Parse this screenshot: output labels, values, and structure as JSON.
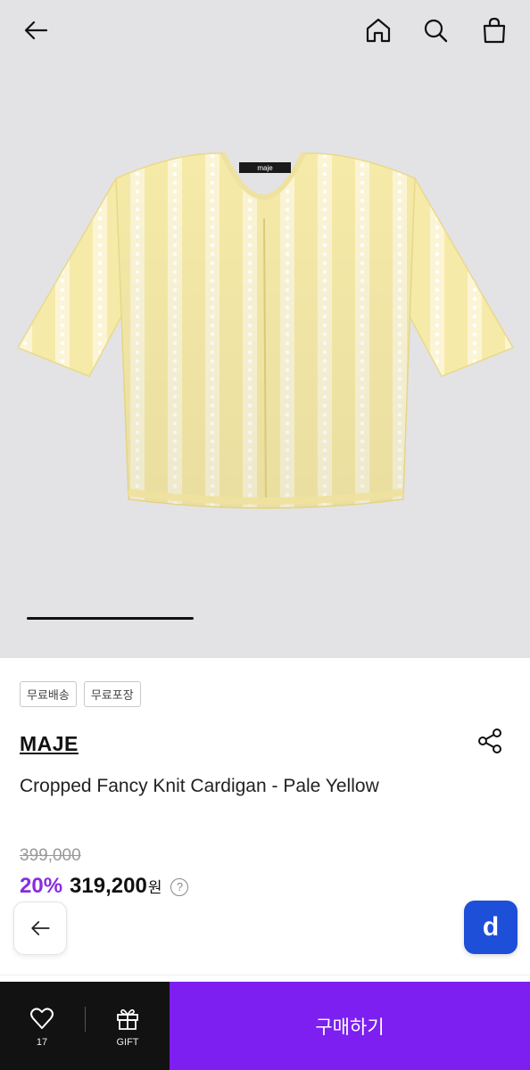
{
  "header": {
    "back_icon": "arrow-left-icon",
    "home_icon": "home-icon",
    "search_icon": "search-icon",
    "cart_icon": "shopping-bag-icon"
  },
  "gallery": {
    "label_on_garment": "maje",
    "progress": 0.35
  },
  "tags": [
    "무료배송",
    "무료포장"
  ],
  "product": {
    "brand": "MAJE",
    "name": "Cropped Fancy Knit Cardigan - Pale Yellow",
    "original_price": "399,000",
    "discount": "20%",
    "price": "319,200",
    "currency": "원",
    "help": "?"
  },
  "floating": {
    "back_icon": "arrow-left-icon",
    "app_badge": "d"
  },
  "bottom_bar": {
    "wish_count": "17",
    "gift_label": "GIFT",
    "buy_label": "구매하기"
  },
  "colors": {
    "buy": "#7c1ff0",
    "discount": "#8a2be2",
    "app_badge": "#1e4fd8",
    "bar": "#121212"
  }
}
